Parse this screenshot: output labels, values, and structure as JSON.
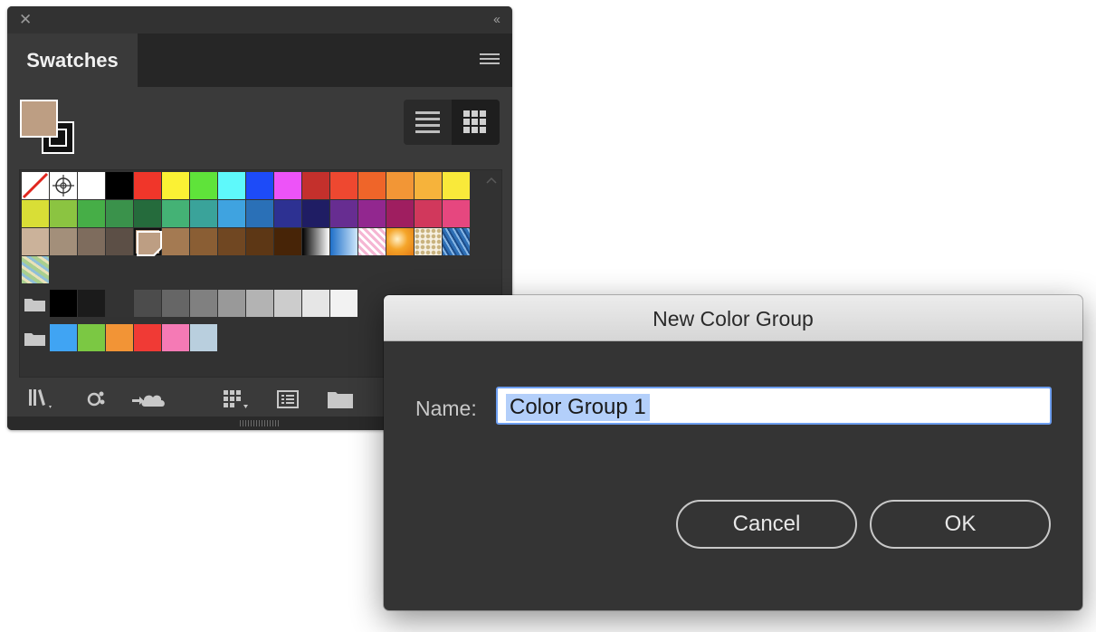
{
  "panel": {
    "tab_label": "Swatches",
    "close_glyph": "✕",
    "collapse_glyph": "‹‹",
    "fill_color": "#bd9e83"
  },
  "swatches": {
    "row1": [
      "none",
      "registration",
      "#ffffff",
      "#000000",
      "#f0362a",
      "#fbf134",
      "#5fe33a",
      "#5ef9fb",
      "#1d4bf8",
      "#ed53f8",
      "#c4302c",
      "#ee4830",
      "#ef6529",
      "#f29636",
      "#f6b33b",
      "#f9e93a"
    ],
    "row2": [
      "#d9de36",
      "#8bc441",
      "#46ae47",
      "#3a924b",
      "#256b3c",
      "#44b275",
      "#3aa39a",
      "#3fa3e0",
      "#2a70b7",
      "#2d3192",
      "#1f1d64",
      "#672d91",
      "#92278f",
      "#9f1e60",
      "#d1385c",
      "#e6477f"
    ],
    "row3": [
      "#cbb29a",
      "#a38f7a",
      "#7e6c5d",
      "#5c4f46",
      "fill-selected",
      "#a47a52",
      "#8a5e34",
      "#704722",
      "#5d3715",
      "#472407",
      "gradient-bw",
      "gradient-blue",
      "pattern-pink",
      "gradient-orange",
      "pattern-dots",
      "pattern-blue"
    ],
    "row4": [
      "pattern-leaf"
    ],
    "gray_group": [
      "#000000",
      "#1b1b1b",
      "#333333",
      "#4c4c4c",
      "#666666",
      "#808080",
      "#999999",
      "#b3b3b3",
      "#cccccc",
      "#e6e6e6",
      "#f2f2f2"
    ],
    "color_group": [
      "#40a4f3",
      "#7bc843",
      "#f29436",
      "#f03a35",
      "#f57ab5",
      "#b9cfde"
    ]
  },
  "bottom_icons": [
    "library-menu-icon",
    "show-kinds-icon",
    "cc-libraries-icon",
    "swatch-options-icon",
    "color-group-icon",
    "new-folder-icon"
  ],
  "dialog": {
    "title": "New Color Group",
    "name_label": "Name:",
    "name_value": "Color Group 1",
    "cancel_label": "Cancel",
    "ok_label": "OK"
  }
}
